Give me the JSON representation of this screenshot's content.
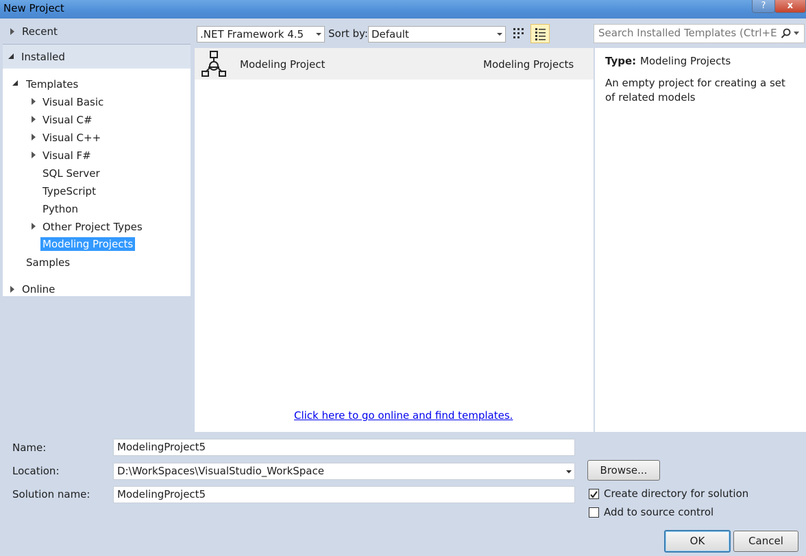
{
  "window": {
    "title": "New Project",
    "help_glyph": "?",
    "close_glyph": "x"
  },
  "left_pane": {
    "recent": "Recent",
    "installed": "Installed",
    "templates": "Templates",
    "items": [
      "Visual Basic",
      "Visual C#",
      "Visual C++",
      "Visual F#",
      "SQL Server",
      "TypeScript",
      "Python",
      "Other Project Types",
      "Modeling Projects"
    ],
    "selected_item": "Modeling Projects",
    "samples": "Samples",
    "online": "Online"
  },
  "toolbar": {
    "framework": ".NET Framework 4.5",
    "sort_label": "Sort by:",
    "sort_value": "Default",
    "search_placeholder": "Search Installed Templates (Ctrl+E)",
    "view_icons": [
      "small-icons-view-icon",
      "list-view-icon"
    ]
  },
  "templates": [
    {
      "name": "Modeling Project",
      "category": "Modeling Projects",
      "icon": "modeling-project-icon"
    }
  ],
  "online_link": "Click here to go online and find templates.",
  "details": {
    "type_label": "Type:",
    "type_value": "Modeling Projects",
    "description": "An empty project for creating a set of related models"
  },
  "form": {
    "name_label": "Name:",
    "name_value": "ModelingProject5",
    "location_label": "Location:",
    "location_value": "D:\\WorkSpaces\\VisualStudio_WorkSpace",
    "solution_label": "Solution name:",
    "solution_value": "ModelingProject5",
    "browse": "Browse...",
    "create_dir": "Create directory for solution",
    "create_dir_checked": true,
    "add_source": "Add to source control",
    "add_source_checked": false,
    "ok": "OK",
    "cancel": "Cancel"
  }
}
